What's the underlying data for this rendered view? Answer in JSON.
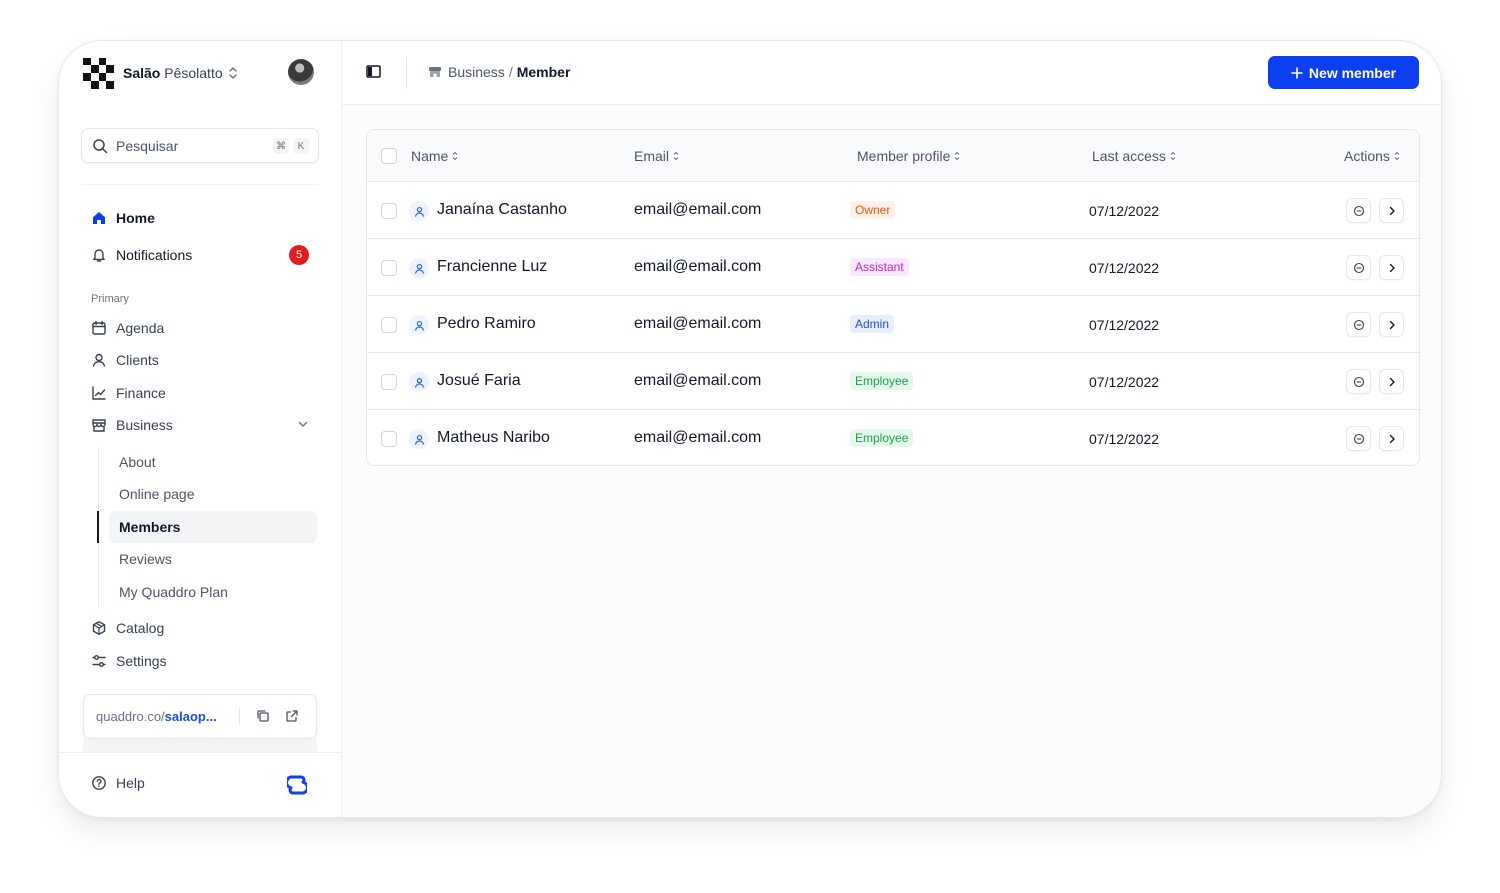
{
  "sidebar": {
    "workspace_name_bold": "Salão",
    "workspace_name_rest": "Pêsolatto",
    "search": {
      "placeholder": "Pesquisar",
      "shortcut_mod": "⌘",
      "shortcut_key": "K"
    },
    "top_items": [
      {
        "label": "Home",
        "icon": "home-icon"
      },
      {
        "label": "Notifications",
        "icon": "bell-icon",
        "badge": "5"
      }
    ],
    "section_label": "Primary",
    "primary_items": [
      {
        "label": "Agenda",
        "icon": "calendar-icon"
      },
      {
        "label": "Clients",
        "icon": "user-icon"
      },
      {
        "label": "Finance",
        "icon": "chart-icon"
      },
      {
        "label": "Business",
        "icon": "store-icon"
      }
    ],
    "business_sub_items": [
      {
        "label": "About"
      },
      {
        "label": "Online page"
      },
      {
        "label": "Members",
        "active": true
      },
      {
        "label": "Reviews"
      },
      {
        "label": "My Quaddro Plan"
      }
    ],
    "bottom_items": [
      {
        "label": "Catalog",
        "icon": "box-icon"
      },
      {
        "label": "Settings",
        "icon": "sliders-icon"
      }
    ],
    "url": {
      "prefix": "quaddro.co/",
      "slug": "salaop..."
    },
    "help_label": "Help"
  },
  "header": {
    "breadcrumb_parent": "Business",
    "breadcrumb_separator": "/",
    "breadcrumb_current": "Member",
    "new_button_label": "New member"
  },
  "table": {
    "columns": [
      "Name",
      "Email",
      "Member profile",
      "Last access",
      "Actions"
    ],
    "rows": [
      {
        "name": "Janaína Castanho",
        "email": "email@email.com",
        "profile": "Owner",
        "last_access": "07/12/2022"
      },
      {
        "name": "Francienne Luz",
        "email": "email@email.com",
        "profile": "Assistant",
        "last_access": "07/12/2022"
      },
      {
        "name": "Pedro Ramiro",
        "email": "email@email.com",
        "profile": "Admin",
        "last_access": "07/12/2022"
      },
      {
        "name": "Josué Faria",
        "email": "email@email.com",
        "profile": "Employee",
        "last_access": "07/12/2022"
      },
      {
        "name": "Matheus Naribo",
        "email": "email@email.com",
        "profile": "Employee",
        "last_access": "07/12/2022"
      }
    ]
  },
  "colors": {
    "accent": "#0b3ff0",
    "badge_red": "#e11d1d",
    "owner": "#ea580c",
    "assistant": "#c026d3",
    "admin": "#1d4ed8",
    "employee": "#16a34a"
  }
}
